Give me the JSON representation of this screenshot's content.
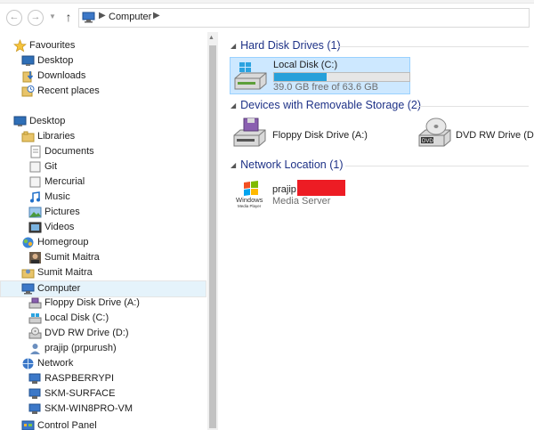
{
  "window": {
    "title": "Computer"
  },
  "nav": {
    "back_icon": "back-arrow-icon",
    "forward_icon": "forward-arrow-icon",
    "recent_icon": "chevron-down-icon",
    "up_icon": "up-arrow-icon",
    "breadcrumb": [
      "Computer"
    ]
  },
  "sidebar": {
    "favourites": {
      "label": "Favourites",
      "items": [
        {
          "label": "Desktop",
          "icon": "desktop-icon"
        },
        {
          "label": "Downloads",
          "icon": "downloads-icon"
        },
        {
          "label": "Recent places",
          "icon": "recent-places-icon"
        }
      ]
    },
    "desktop": {
      "label": "Desktop"
    },
    "libraries": {
      "label": "Libraries",
      "items": [
        {
          "label": "Documents",
          "icon": "documents-icon"
        },
        {
          "label": "Git",
          "icon": "folder-icon"
        },
        {
          "label": "Mercurial",
          "icon": "folder-icon"
        },
        {
          "label": "Music",
          "icon": "music-icon"
        },
        {
          "label": "Pictures",
          "icon": "pictures-icon"
        },
        {
          "label": "Videos",
          "icon": "videos-icon"
        }
      ]
    },
    "homegroup": {
      "label": "Homegroup",
      "items": [
        {
          "label": "Sumit Maitra",
          "icon": "user-avatar-icon"
        }
      ]
    },
    "user": {
      "label": "Sumit Maitra"
    },
    "computer": {
      "label": "Computer",
      "items": [
        {
          "label": "Floppy Disk Drive (A:)",
          "icon": "floppy-drive-icon"
        },
        {
          "label": "Local Disk (C:)",
          "icon": "hard-disk-icon"
        },
        {
          "label": "DVD RW Drive (D:)",
          "icon": "dvd-drive-icon"
        },
        {
          "label": "prajip (prpurush)",
          "icon": "user-icon"
        }
      ]
    },
    "network": {
      "label": "Network",
      "items": [
        {
          "label": "RASPBERRYPI",
          "icon": "network-computer-icon"
        },
        {
          "label": "SKM-SURFACE",
          "icon": "network-computer-icon"
        },
        {
          "label": "SKM-WIN8PRO-VM",
          "icon": "network-computer-icon"
        }
      ]
    },
    "control_panel": {
      "label": "Control Panel"
    }
  },
  "content": {
    "groups": [
      {
        "title": "Hard Disk Drives (1)",
        "items": [
          {
            "name": "Local Disk (C:)",
            "sub": "39.0 GB free of 63.6 GB",
            "used_fraction": 0.387
          }
        ]
      },
      {
        "title": "Devices with Removable Storage (2)",
        "items": [
          {
            "name": "Floppy Disk Drive (A:)"
          },
          {
            "name": "DVD RW Drive (D:)"
          }
        ]
      },
      {
        "title": "Network Location (1)",
        "items": [
          {
            "name": "prajip",
            "sub": "Media Server",
            "logo_text": "Windows Media Player"
          }
        ]
      }
    ]
  },
  "colors": {
    "accent": "#26a0da",
    "selection": "#cde8ff",
    "group_header": "#1e3287",
    "redaction": "#ed1c24"
  }
}
